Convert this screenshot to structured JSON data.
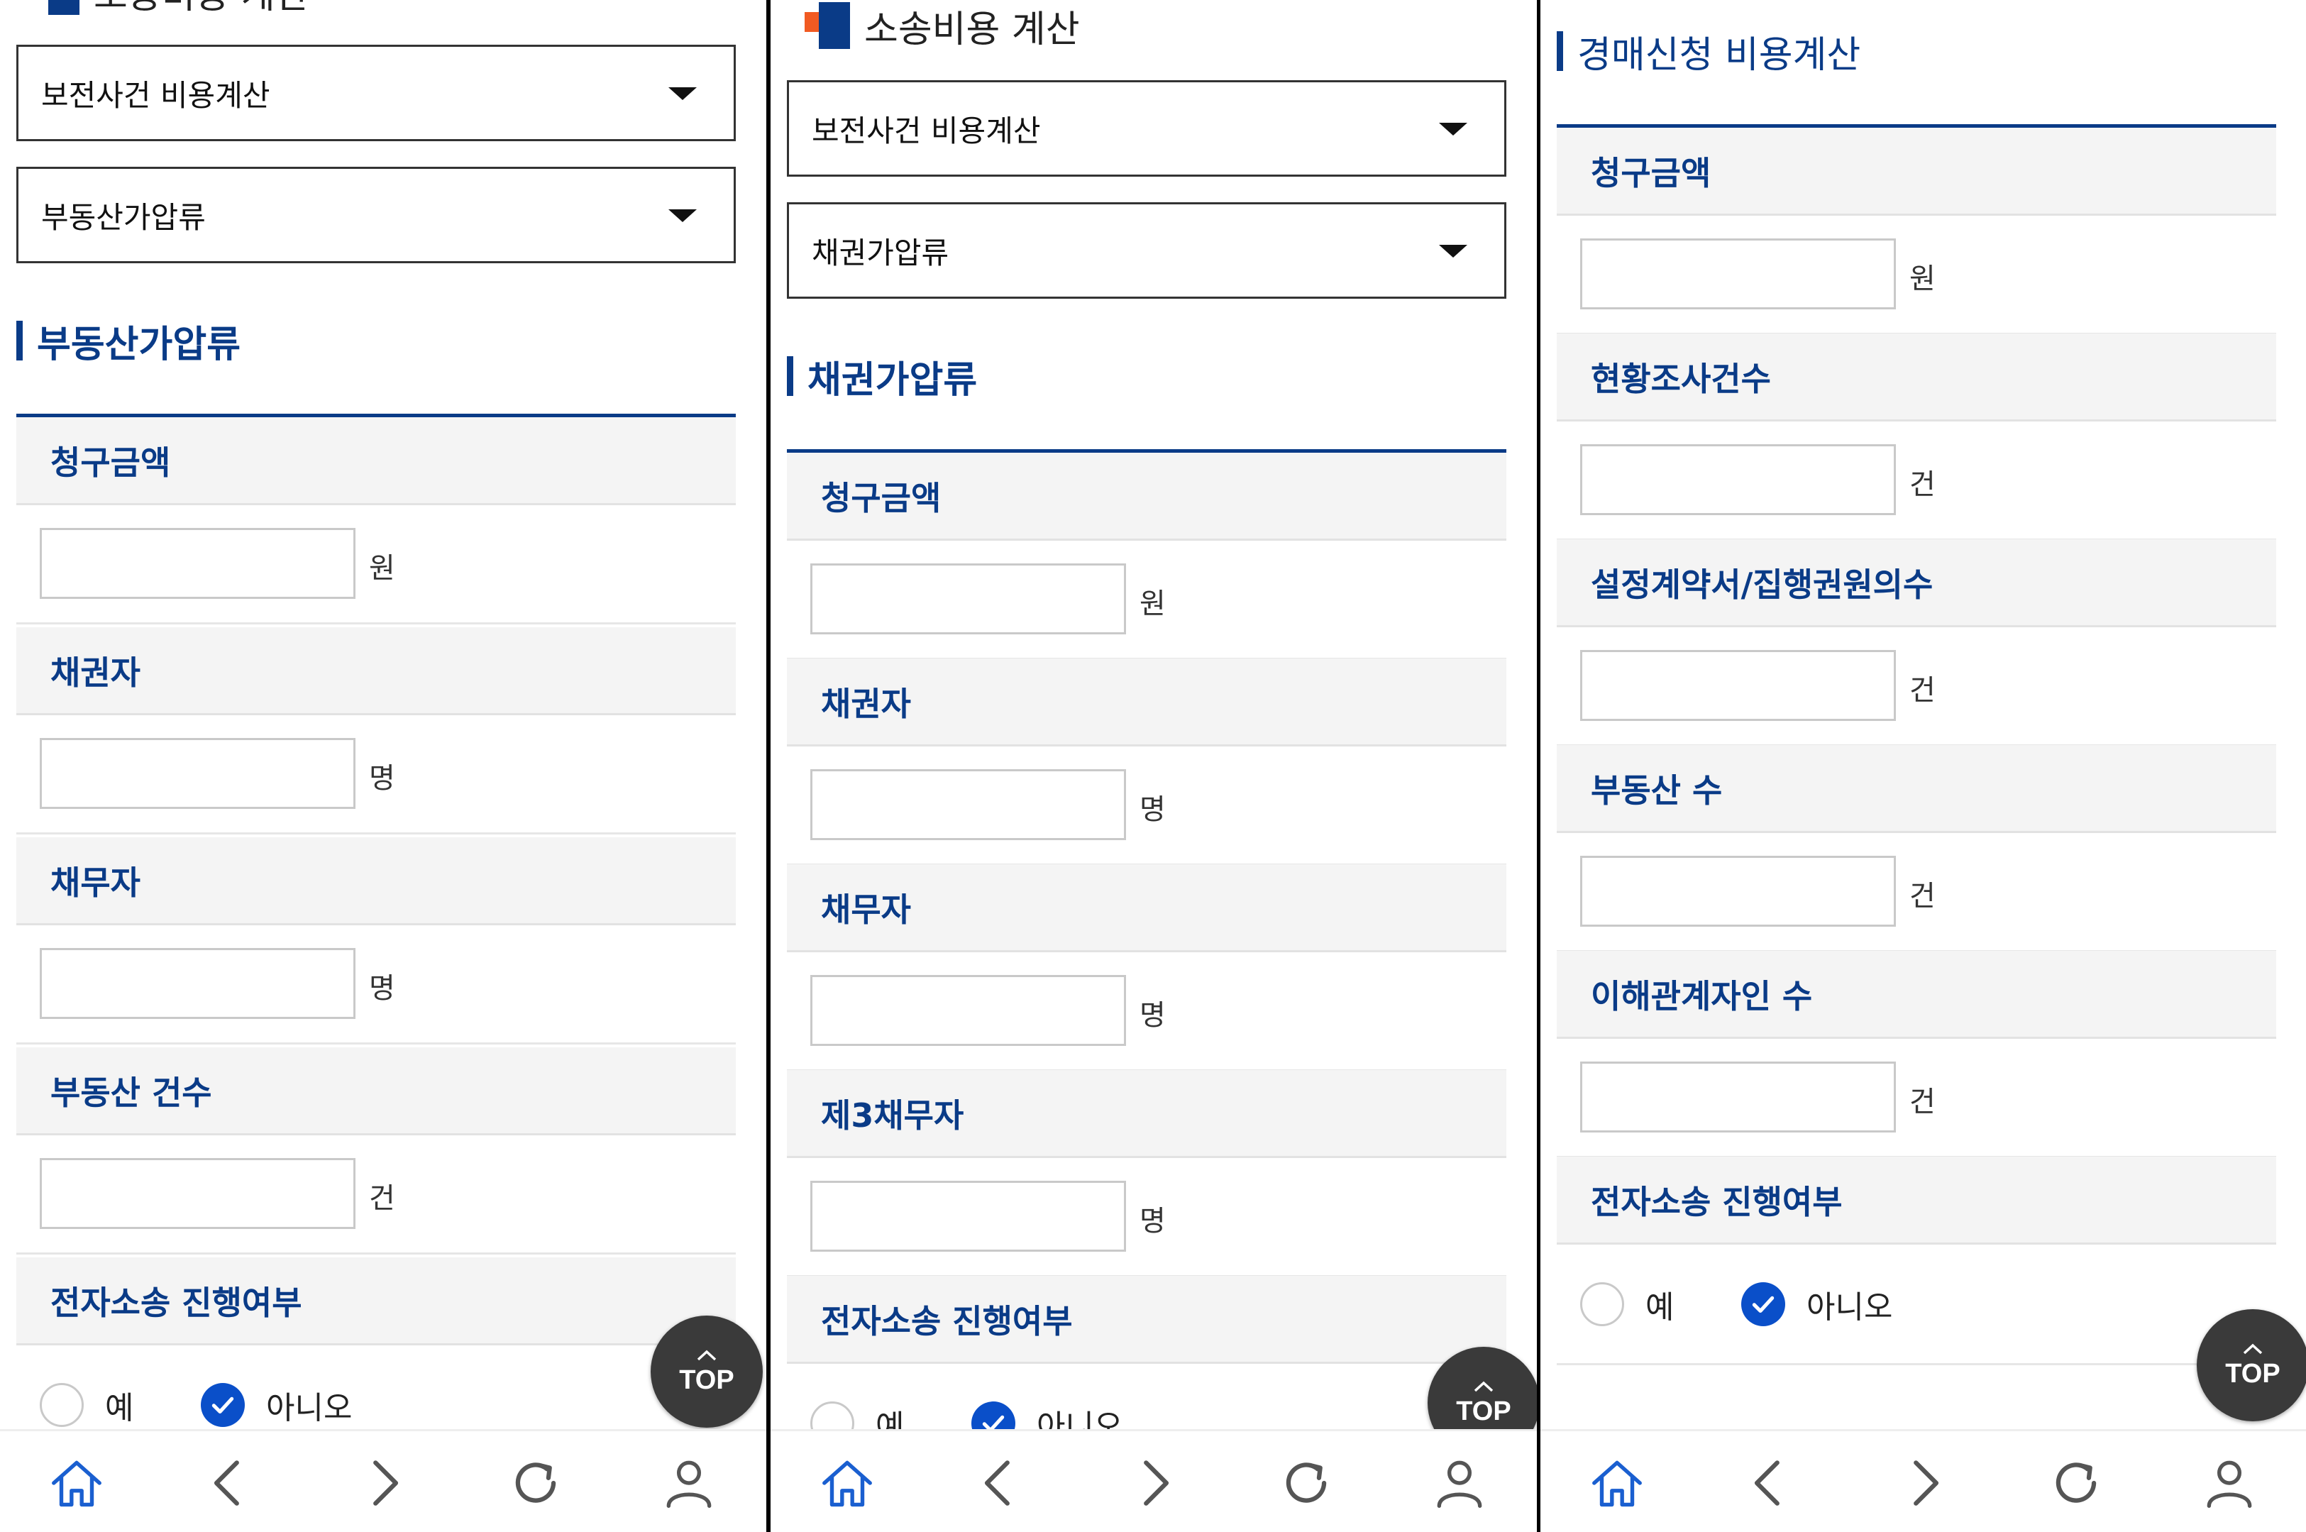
{
  "panels": [
    {
      "page_title": "소송비용 계산",
      "select1": "보전사건 비용계산",
      "select2": "부동산가압류",
      "section_title": "부동산가압류",
      "fields": [
        {
          "label": "청구금액",
          "unit": "원"
        },
        {
          "label": "채권자",
          "unit": "명"
        },
        {
          "label": "채무자",
          "unit": "명"
        },
        {
          "label": "부동산 건수",
          "unit": "건"
        }
      ],
      "ecourt_label": "전자소송 진행여부",
      "radio_yes": "예",
      "radio_no": "아니오",
      "radio_selected": "no",
      "top_label": "TOP"
    },
    {
      "page_title": "소송비용 계산",
      "select1": "보전사건 비용계산",
      "select2": "채권가압류",
      "section_title": "채권가압류",
      "fields": [
        {
          "label": "청구금액",
          "unit": "원"
        },
        {
          "label": "채권자",
          "unit": "명"
        },
        {
          "label": "채무자",
          "unit": "명"
        },
        {
          "label": "제3채무자",
          "unit": "명"
        }
      ],
      "ecourt_label": "전자소송 진행여부",
      "radio_yes": "예",
      "radio_no": "아니오",
      "radio_selected": "no",
      "top_label": "TOP"
    },
    {
      "section_title": "경매신청 비용계산",
      "fields": [
        {
          "label": "청구금액",
          "unit": "원"
        },
        {
          "label": "현황조사건수",
          "unit": "건"
        },
        {
          "label": "설정계약서/집행권원의수",
          "unit": "건"
        },
        {
          "label": "부동산 수",
          "unit": "건"
        },
        {
          "label": "이해관계자인 수",
          "unit": "건"
        }
      ],
      "ecourt_label": "전자소송 진행여부",
      "radio_yes": "예",
      "radio_no": "아니오",
      "radio_selected": "no",
      "top_label": "TOP"
    }
  ],
  "nav_icons": [
    "home-icon",
    "back-chevron-icon",
    "forward-chevron-icon",
    "refresh-icon",
    "user-icon"
  ],
  "colors": {
    "accent": "#0a3b87",
    "check": "#0a4fc9",
    "orange": "#f15a22"
  }
}
